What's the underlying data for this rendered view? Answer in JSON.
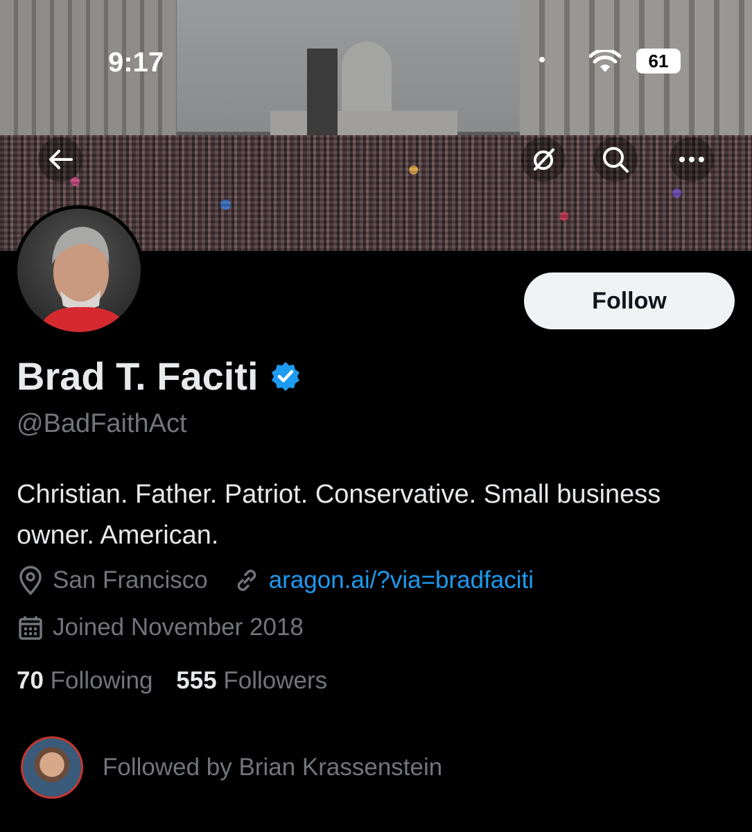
{
  "status_bar": {
    "time": "9:17",
    "battery": "61"
  },
  "profile": {
    "name": "Brad T. Faciti",
    "handle": "@BadFaithAct",
    "bio": "Christian. Father. Patriot. Conservative. Small business owner. American.",
    "location": "San Francisco",
    "website": "aragon.ai/?via=bradfaciti",
    "joined": "Joined November 2018",
    "following_count": "70",
    "following_label": "Following",
    "followers_count": "555",
    "followers_label": "Followers",
    "followed_by": "Followed by Brian Krassenstein"
  },
  "actions": {
    "follow_label": "Follow"
  },
  "colors": {
    "accent": "#1d9bf0",
    "muted": "#71767b",
    "background": "#000000"
  }
}
